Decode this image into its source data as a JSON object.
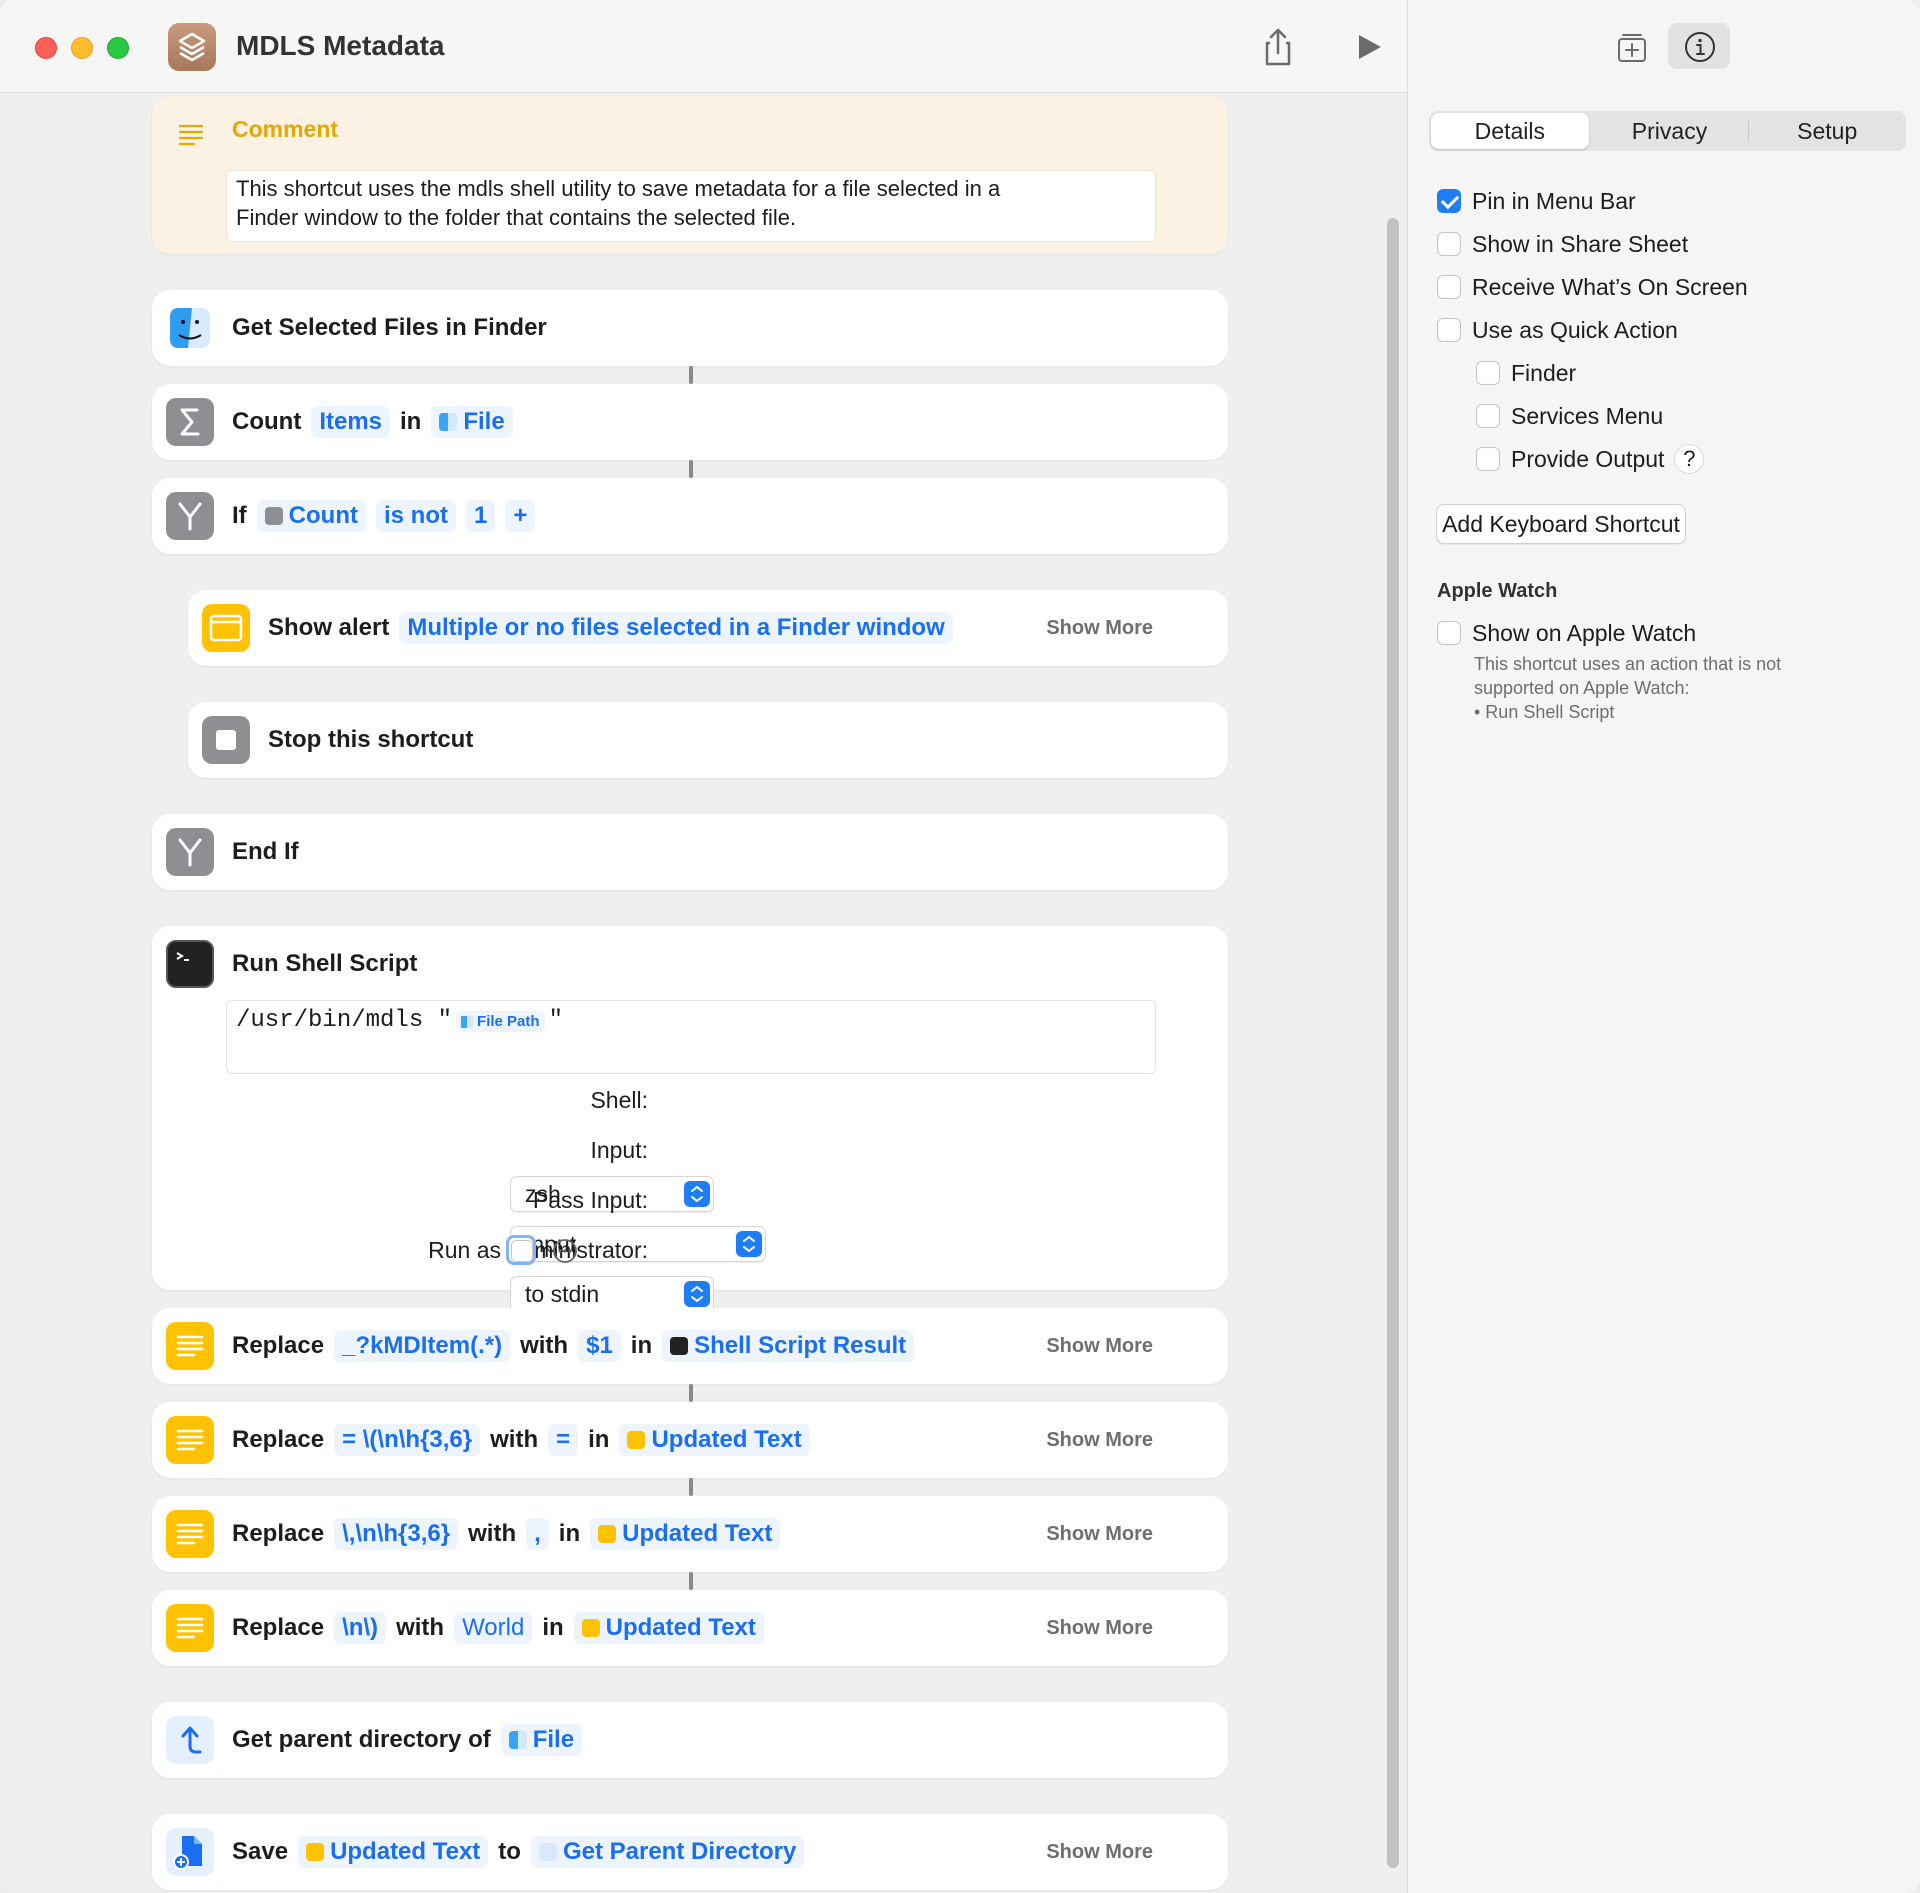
{
  "window": {
    "title": "MDLS Metadata"
  },
  "sidebar": {
    "tabs": [
      "Details",
      "Privacy",
      "Setup"
    ],
    "active_tab": "Details",
    "options": [
      {
        "label": "Pin in Menu Bar",
        "checked": true
      },
      {
        "label": "Show in Share Sheet",
        "checked": false
      },
      {
        "label": "Receive What’s On Screen",
        "checked": false
      },
      {
        "label": "Use as Quick Action",
        "checked": false
      }
    ],
    "quick_action_options": [
      {
        "label": "Finder",
        "checked": false
      },
      {
        "label": "Services Menu",
        "checked": false
      },
      {
        "label": "Provide Output",
        "checked": false
      }
    ],
    "help_label": "?",
    "keyboard_shortcut_label": "Add Keyboard Shortcut",
    "apple_watch": {
      "heading": "Apple Watch",
      "option": "Show on Apple Watch",
      "note_line1": "This shortcut uses an action that is not",
      "note_line2": "supported on Apple Watch:",
      "note_line3": "• Run Shell Script"
    }
  },
  "actions": {
    "comment": {
      "title": "Comment",
      "text_line1": "This shortcut uses the mdls shell utility to save metadata for a file selected in a",
      "text_line2": "Finder window to the folder that contains the selected file."
    },
    "get_selected": {
      "label": "Get Selected Files in Finder"
    },
    "count": {
      "verb": "Count",
      "what": "Items",
      "in": "in",
      "source": "File"
    },
    "if": {
      "verb": "If",
      "var": "Count",
      "cond": "is not",
      "value": "1",
      "add": "+"
    },
    "alert": {
      "verb": "Show alert",
      "message": "Multiple or no files selected in a Finder window",
      "show_more": "Show More"
    },
    "stop": {
      "label": "Stop this shortcut"
    },
    "endif": {
      "label": "End If"
    },
    "shell": {
      "title": "Run Shell Script",
      "script_prefix": "/usr/bin/mdls \"",
      "script_var": "File Path",
      "script_suffix": "\"",
      "shell_label": "Shell:",
      "shell_value": "zsh",
      "input_label": "Input:",
      "input_value": "Input",
      "pass_label": "Pass Input:",
      "pass_value": "to stdin",
      "admin_label": "Run as Administrator:"
    },
    "replace1": {
      "verb": "Replace",
      "find": "_?kMDItem(.*)",
      "with": "with",
      "repl": "$1",
      "in": "in",
      "source": "Shell Script Result",
      "show_more": "Show More"
    },
    "replace2": {
      "verb": "Replace",
      "find": "= \\(\\n\\h{3,6}",
      "with": "with",
      "repl": "=",
      "in": "in",
      "source": "Updated Text",
      "show_more": "Show More"
    },
    "replace3": {
      "verb": "Replace",
      "find": "\\,\\n\\h{3,6}",
      "with": "with",
      "repl": ",",
      "in": "in",
      "source": "Updated Text",
      "show_more": "Show More"
    },
    "replace4": {
      "verb": "Replace",
      "find": "\\n\\)",
      "with": "with",
      "repl": "World",
      "in": "in",
      "source": "Updated Text",
      "show_more": "Show More"
    },
    "parent": {
      "verb": "Get parent directory of",
      "source": "File"
    },
    "save": {
      "verb": "Save",
      "what": "Updated Text",
      "to": "to",
      "dest": "Get Parent Directory",
      "show_more": "Show More"
    }
  }
}
